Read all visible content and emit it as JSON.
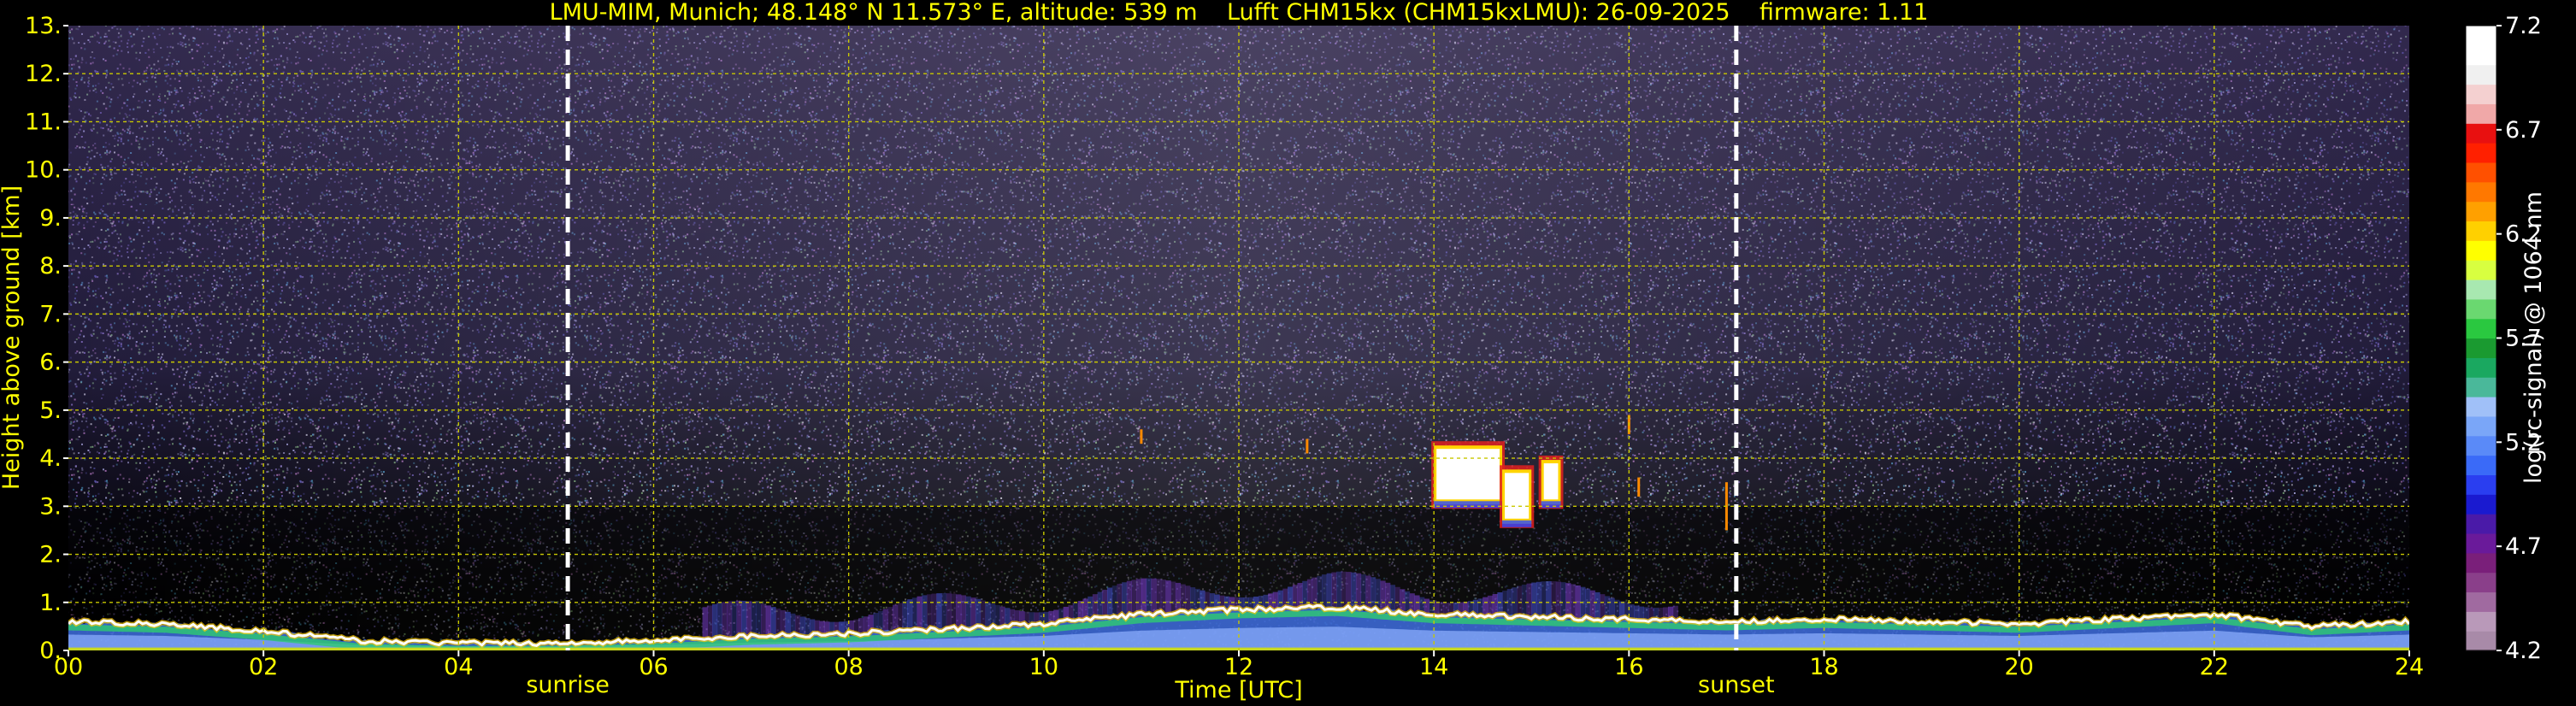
{
  "chart_data": {
    "type": "heatmap",
    "title": "LMU-MIM, Munich; 48.148° N 11.573° E, altitude: 539 m    Lufft CHM15kx (CHM15kxLMU): 26-09-2025    firmware: 1.11",
    "xlabel": "Time [UTC]",
    "ylabel": "Height above ground [km]",
    "colorbar_label": "log(rc-signal) @ 1064 nm",
    "xlim": [
      0,
      24
    ],
    "ylim": [
      0,
      13
    ],
    "x_tick_labels": [
      "00",
      "02",
      "04",
      "06",
      "08",
      "10",
      "12",
      "14",
      "16",
      "18",
      "20",
      "22",
      "24"
    ],
    "y_tick_labels": [
      "0.",
      "1.",
      "2.",
      "3.",
      "4.",
      "5.",
      "6.",
      "7.",
      "8.",
      "9.",
      "10.",
      "11.",
      "12.",
      "13."
    ],
    "colorbar_range": [
      4.2,
      7.2
    ],
    "colorbar_tick_labels": [
      "4.2",
      "4.7",
      "5.2",
      "5.7",
      "6.2",
      "6.7",
      "7.2"
    ],
    "grid": true,
    "markers": [
      {
        "label": "sunrise",
        "time": 5.12
      },
      {
        "label": "sunset",
        "time": 17.1
      }
    ],
    "boundary_layer_top_km": [
      [
        0,
        0.6
      ],
      [
        1,
        0.55
      ],
      [
        2,
        0.4
      ],
      [
        3,
        0.2
      ],
      [
        4,
        0.15
      ],
      [
        5,
        0.15
      ],
      [
        6,
        0.2
      ],
      [
        7,
        0.3
      ],
      [
        8,
        0.35
      ],
      [
        9,
        0.45
      ],
      [
        10,
        0.55
      ],
      [
        11,
        0.75
      ],
      [
        12,
        0.85
      ],
      [
        13,
        0.9
      ],
      [
        14,
        0.75
      ],
      [
        15,
        0.7
      ],
      [
        16,
        0.65
      ],
      [
        17,
        0.6
      ],
      [
        18,
        0.65
      ],
      [
        19,
        0.6
      ],
      [
        20,
        0.55
      ],
      [
        21,
        0.65
      ],
      [
        22,
        0.75
      ],
      [
        23,
        0.5
      ],
      [
        24,
        0.6
      ]
    ],
    "cloud_features": [
      {
        "time_start": 14.0,
        "time_end": 14.7,
        "base_km": 3.0,
        "top_km": 4.3
      },
      {
        "time_start": 14.7,
        "time_end": 15.0,
        "base_km": 2.6,
        "top_km": 3.8
      },
      {
        "time_start": 15.1,
        "time_end": 15.3,
        "base_km": 3.0,
        "top_km": 4.0
      }
    ]
  }
}
